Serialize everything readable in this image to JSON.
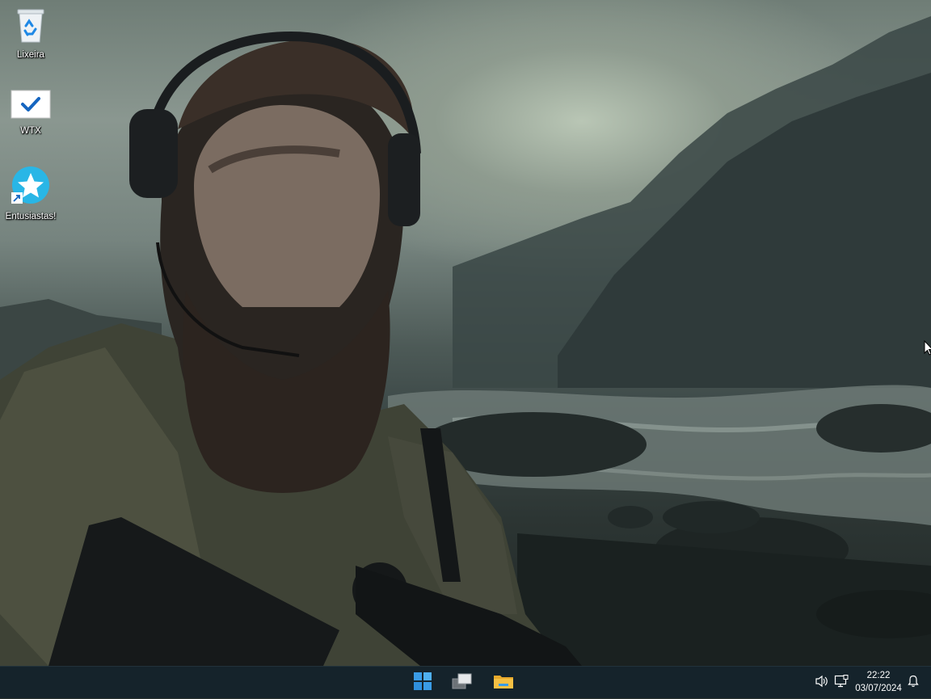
{
  "desktop": {
    "icons": [
      {
        "label": "Lixeira",
        "icon": "recycle-bin-icon"
      },
      {
        "label": "WTX",
        "icon": "checkmark-icon"
      },
      {
        "label": "Entusiastas!",
        "icon": "star-shortcut-icon"
      }
    ]
  },
  "taskbar": {
    "apps": [
      {
        "icon": "windows-start-icon"
      },
      {
        "icon": "task-view-icon"
      },
      {
        "icon": "file-explorer-icon"
      }
    ],
    "tray": {
      "volume_icon": "speaker-icon",
      "network_icon": "network-monitor-icon",
      "notification_icon": "bell-icon"
    },
    "clock": {
      "time": "22:22",
      "date": "03/07/2024"
    }
  },
  "colors": {
    "taskbar": "#15232b",
    "start_blue": "#3a9ce6",
    "folder_yellow": "#f5c043",
    "star_cyan": "#29b6e6"
  }
}
